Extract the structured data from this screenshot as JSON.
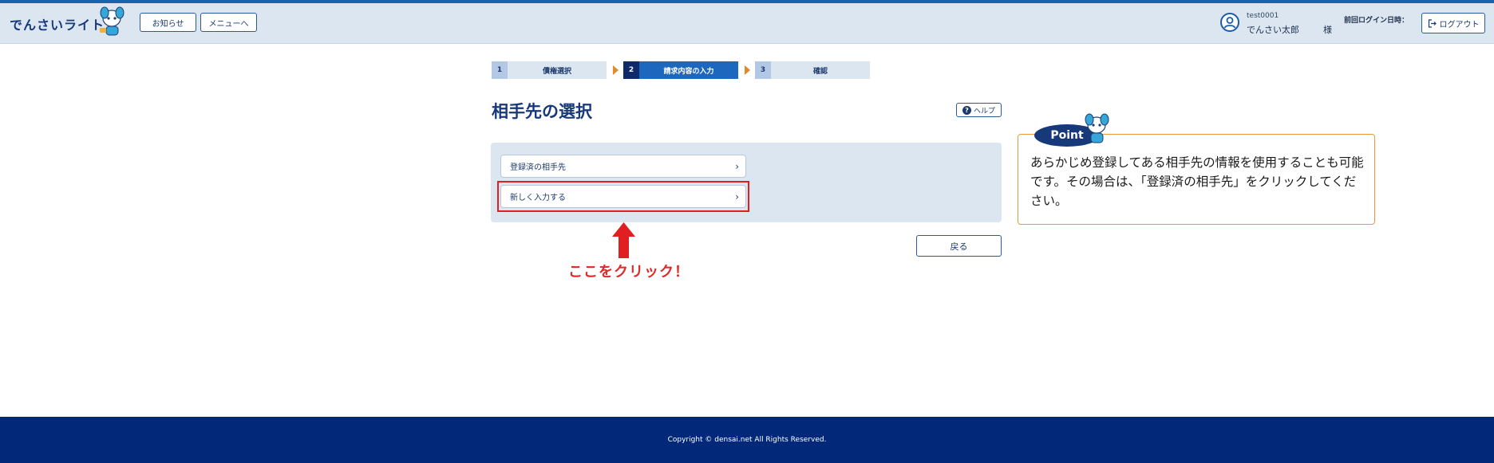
{
  "header": {
    "logo_text": "でんさいライト",
    "notice_label": "お知らせ",
    "menu_label": "メニューへ",
    "user_id": "test0001",
    "user_name": "でんさい太郎",
    "honorific": "様",
    "last_login_label": "前回ログイン日時：",
    "logout_label": "ログアウト"
  },
  "steps": [
    {
      "num": "1",
      "label": "債権選択",
      "state": "inactive"
    },
    {
      "num": "2",
      "label": "請求内容の入力",
      "state": "active"
    },
    {
      "num": "3",
      "label": "確認",
      "state": "inactive"
    }
  ],
  "main": {
    "title": "相手先の選択",
    "help_label": "ヘルプ",
    "options": [
      {
        "label": "登録済の相手先"
      },
      {
        "label": "新しく入力する"
      }
    ],
    "back_label": "戻る",
    "annotation": "ここをクリック！"
  },
  "point": {
    "badge": "Point",
    "text": "あらかじめ登録してある相手先の情報を使用することも可能です。その場合は、「登録済の相手先」をクリックしてください。"
  },
  "footer": {
    "copyright": "Copyright © densai.net All Rights Reserved."
  },
  "colors": {
    "brand_navy": "#17397a",
    "step_active": "#1d67be",
    "annotation_red": "#e02020",
    "point_border": "#e79a3a",
    "footer_bg": "#02287a"
  }
}
